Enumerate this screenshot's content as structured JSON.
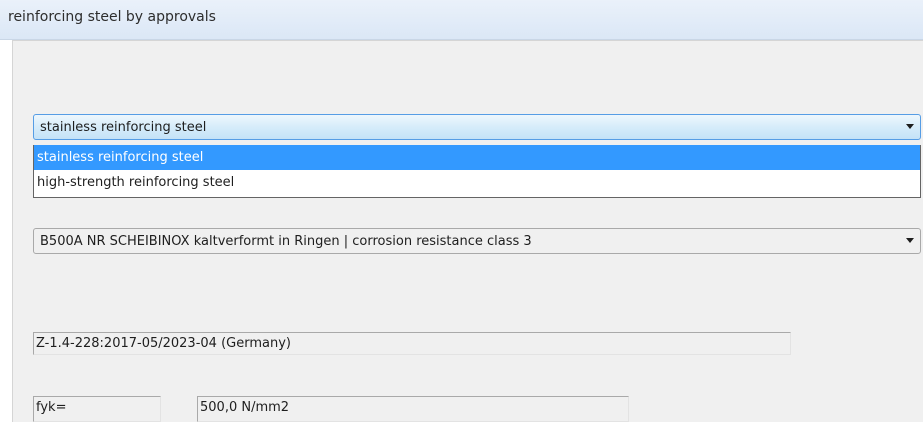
{
  "window": {
    "title": "reinforcing steel by approvals"
  },
  "steel_type_combo": {
    "selected": "stainless reinforcing steel",
    "options": [
      "stainless reinforcing steel",
      "high-strength reinforcing steel"
    ]
  },
  "product_combo": {
    "selected": "B500A NR SCHEIBINOX kaltverformt in Ringen | corrosion resistance class 3"
  },
  "approval": {
    "text": "Z-1.4-228:2017-05/2023-04   (Germany)"
  },
  "fyk": {
    "label": "fyk=",
    "value": "500,0 N/mm2"
  },
  "icons": {
    "dropdown_arrow": "chevron-down-icon"
  },
  "colors": {
    "selection": "#3399ff",
    "focus_border": "#569de5"
  }
}
